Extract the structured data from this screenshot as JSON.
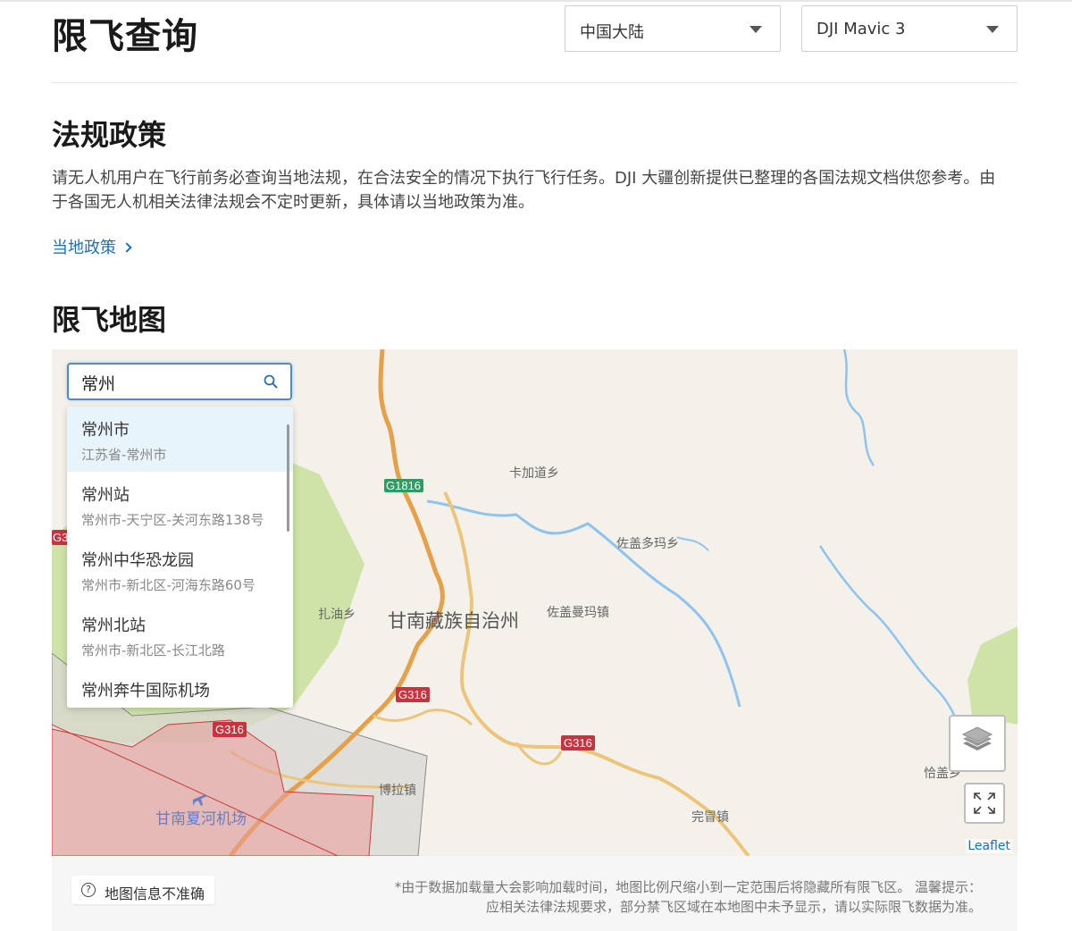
{
  "header": {
    "title": "限飞查询",
    "region_select": "中国大陆",
    "model_select": "DJI Mavic 3"
  },
  "regulations": {
    "heading": "法规政策",
    "paragraph": "请无人机用户在飞行前务必查询当地法规，在合法安全的情况下执行飞行任务。DJI 大疆创新提供已整理的各国法规文档供您参考。由于各国无人机相关法律法规会不定时更新，具体请以当地政策为准。",
    "link_label": "当地政策"
  },
  "map_section": {
    "heading": "限飞地图"
  },
  "search": {
    "value": "常州",
    "icon": "search-icon"
  },
  "suggestions": [
    {
      "name": "常州市",
      "address": "江苏省-常州市"
    },
    {
      "name": "常州站",
      "address": "常州市-天宁区-关河东路138号"
    },
    {
      "name": "常州中华恐龙园",
      "address": "常州市-新北区-河海东路60号"
    },
    {
      "name": "常州北站",
      "address": "常州市-新北区-长江北路"
    },
    {
      "name": "常州奔牛国际机场",
      "address": ""
    }
  ],
  "map_labels": {
    "prefecture": "甘南藏族自治州",
    "towns": [
      "卡加道乡",
      "佐盖多玛乡",
      "扎油乡",
      "佐盖曼玛镇",
      "博拉镇",
      "完冒镇",
      "恰盖乡"
    ],
    "airport": "甘南夏河机场",
    "roads": [
      "G1816",
      "G316",
      "G316",
      "G316",
      "G3"
    ]
  },
  "map_controls": {
    "layers_icon": "layers-icon",
    "fullscreen_icon": "fullscreen-icon",
    "attribution": "Leaflet"
  },
  "footer": {
    "inaccurate_button": "地图信息不准确",
    "note_line1": "*由于数据加载量大会影响加载时间，地图比例尺缩小到一定范围后将隐藏所有限飞区。 温馨提示：",
    "note_line2": "应相关法律法规要求，部分禁飞区域在本地图中未予显示，请以实际限飞数据为准。"
  },
  "colors": {
    "link": "#1f6fb8",
    "search_border": "#4d8ccb",
    "no_fly_zone": "#e89a9a",
    "green_area": "#cfe3a8",
    "river": "#8fc3ee",
    "highway": "#e6a04a"
  }
}
